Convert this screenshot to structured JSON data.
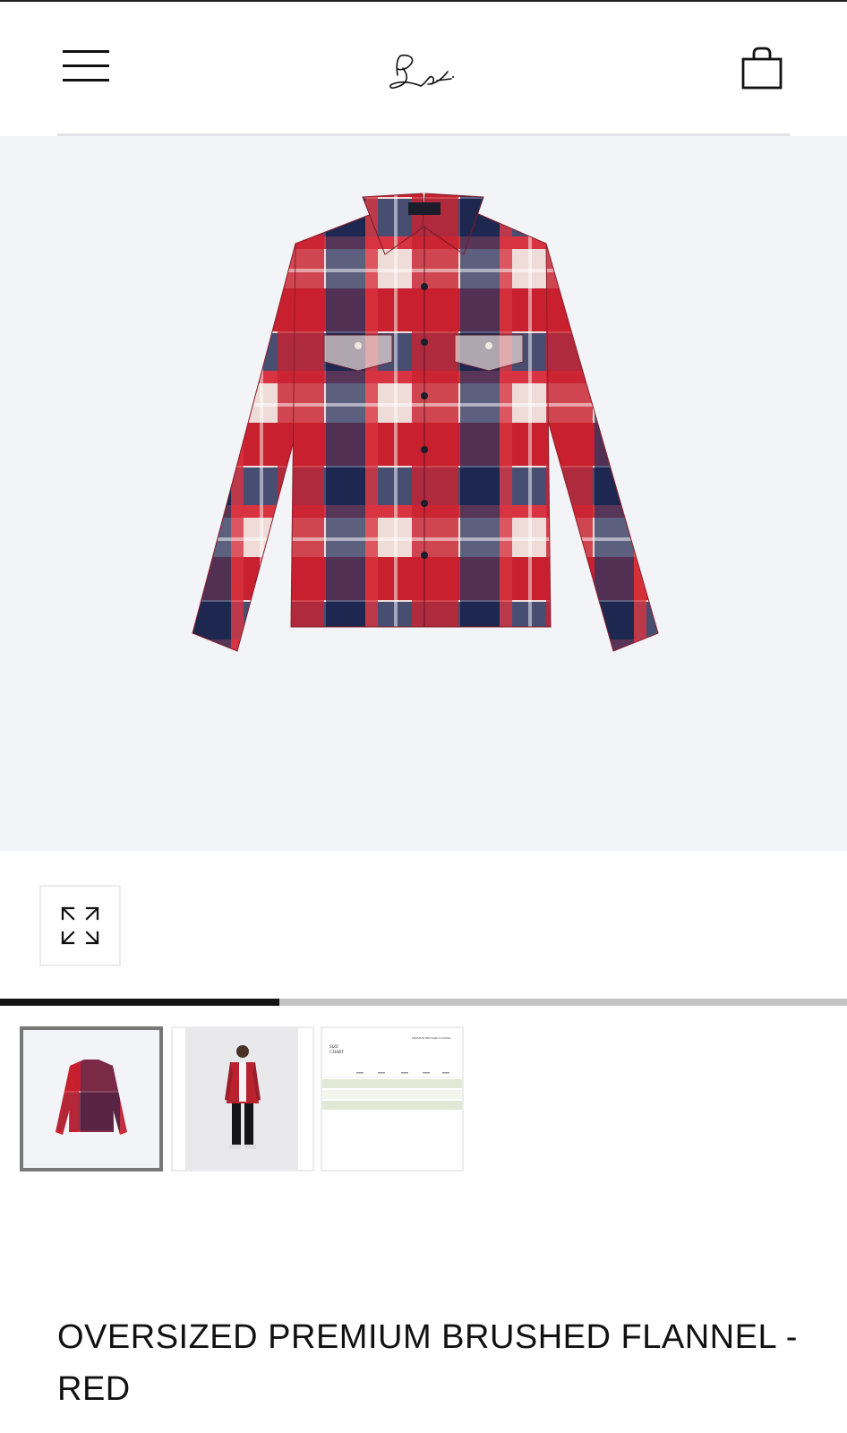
{
  "header": {
    "menu_icon": "hamburger-menu-icon",
    "logo": "signature-logo",
    "cart_icon": "shopping-bag-icon"
  },
  "gallery": {
    "main_image": "plaid-flannel-shirt-front",
    "expand_icon": "expand-arrows-icon",
    "progress": 0.33,
    "thumbnails": [
      {
        "image": "shirt-front-thumbnail",
        "active": true
      },
      {
        "image": "model-wearing-shirt-thumbnail",
        "active": false
      },
      {
        "image": "size-chart-thumbnail",
        "active": false
      }
    ]
  },
  "size_chart": {
    "title_line1": "SIZE",
    "title_line2": "CHART",
    "product": "PREMIUM BRUSHED FLANNEL"
  },
  "product": {
    "title": "OVERSIZED PREMIUM BRUSHED FLANNEL - RED"
  },
  "colors": {
    "shirt_red": "#c8202e",
    "shirt_navy": "#2a3560",
    "shirt_cream": "#efdcd8",
    "hero_background": "#f3f4f8"
  }
}
